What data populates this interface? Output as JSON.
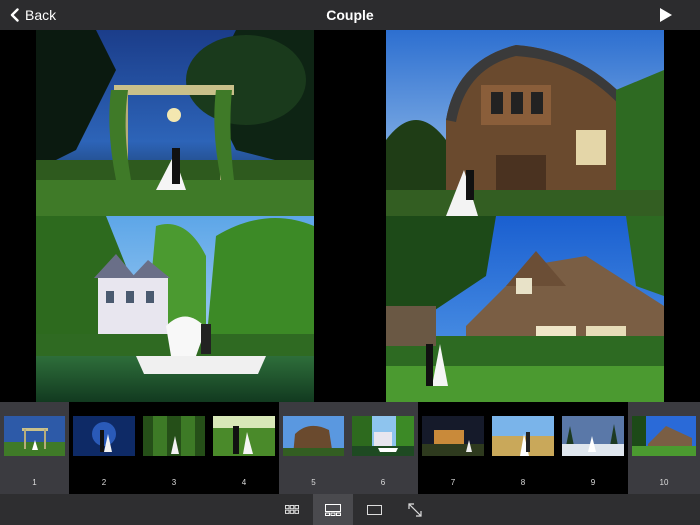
{
  "header": {
    "back_label": "Back",
    "title": "Couple"
  },
  "thumbnails": [
    {
      "num": "1",
      "selected": true
    },
    {
      "num": "2",
      "selected": false
    },
    {
      "num": "3",
      "selected": false
    },
    {
      "num": "4",
      "selected": false
    },
    {
      "num": "5",
      "selected": true
    },
    {
      "num": "6",
      "selected": true
    },
    {
      "num": "7",
      "selected": false
    },
    {
      "num": "8",
      "selected": false
    },
    {
      "num": "9",
      "selected": false
    },
    {
      "num": "10",
      "selected": true
    }
  ],
  "toolbar": {
    "active_view": "spread-view"
  },
  "colors": {
    "topbar": "#2c2c2e",
    "bottombar": "#2e2e30",
    "selected_thumb": "#3b3b40"
  }
}
